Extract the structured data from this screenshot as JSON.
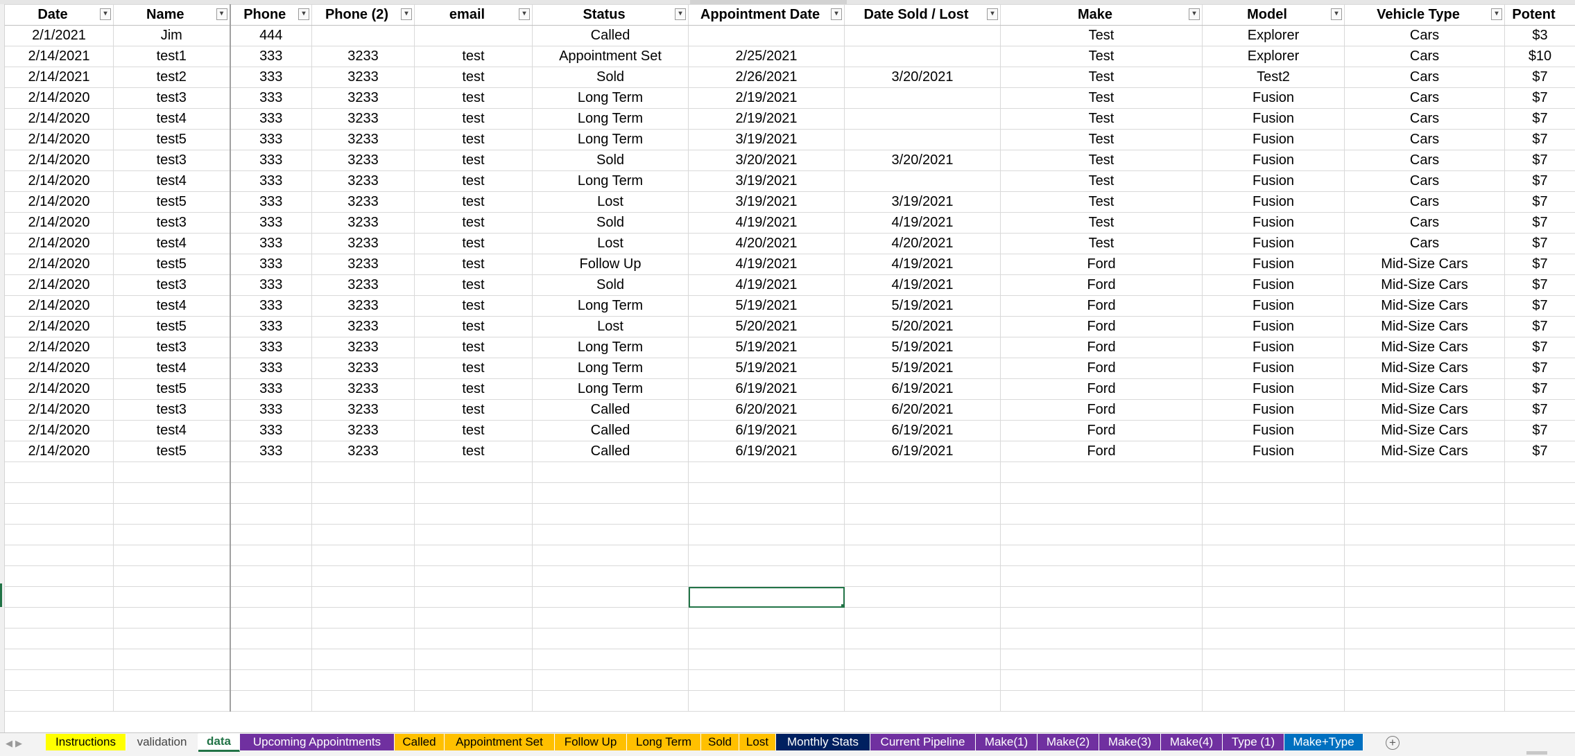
{
  "columns": [
    {
      "label": "Date",
      "width": 157,
      "filter": true
    },
    {
      "label": "Name",
      "width": 168,
      "filter": true,
      "freeze": true
    },
    {
      "label": "Phone",
      "width": 118,
      "filter": true
    },
    {
      "label": "Phone (2)",
      "width": 148,
      "filter": true
    },
    {
      "label": "email",
      "width": 170,
      "filter": true
    },
    {
      "label": "Status",
      "width": 225,
      "filter": true
    },
    {
      "label": "Appointment Date",
      "width": 225,
      "filter": true
    },
    {
      "label": "Date Sold / Lost",
      "width": 225,
      "filter": true
    },
    {
      "label": "Make",
      "width": 291,
      "filter": true
    },
    {
      "label": "Model",
      "width": 205,
      "filter": true
    },
    {
      "label": "Vehicle Type",
      "width": 231,
      "filter": true
    },
    {
      "label": "Potent",
      "width": 102,
      "filter": false,
      "align": "right"
    }
  ],
  "rows": [
    [
      "2/1/2021",
      "Jim",
      "444",
      "",
      "",
      "Called",
      "",
      "",
      "Test",
      "Explorer",
      "Cars",
      "$3"
    ],
    [
      "2/14/2021",
      "test1",
      "333",
      "3233",
      "test",
      "Appointment Set",
      "2/25/2021",
      "",
      "Test",
      "Explorer",
      "Cars",
      "$10"
    ],
    [
      "2/14/2021",
      "test2",
      "333",
      "3233",
      "test",
      "Sold",
      "2/26/2021",
      "3/20/2021",
      "Test",
      "Test2",
      "Cars",
      "$7"
    ],
    [
      "2/14/2020",
      "test3",
      "333",
      "3233",
      "test",
      "Long Term",
      "2/19/2021",
      "",
      "Test",
      "Fusion",
      "Cars",
      "$7"
    ],
    [
      "2/14/2020",
      "test4",
      "333",
      "3233",
      "test",
      "Long Term",
      "2/19/2021",
      "",
      "Test",
      "Fusion",
      "Cars",
      "$7"
    ],
    [
      "2/14/2020",
      "test5",
      "333",
      "3233",
      "test",
      "Long Term",
      "3/19/2021",
      "",
      "Test",
      "Fusion",
      "Cars",
      "$7"
    ],
    [
      "2/14/2020",
      "test3",
      "333",
      "3233",
      "test",
      "Sold",
      "3/20/2021",
      "3/20/2021",
      "Test",
      "Fusion",
      "Cars",
      "$7"
    ],
    [
      "2/14/2020",
      "test4",
      "333",
      "3233",
      "test",
      "Long Term",
      "3/19/2021",
      "",
      "Test",
      "Fusion",
      "Cars",
      "$7"
    ],
    [
      "2/14/2020",
      "test5",
      "333",
      "3233",
      "test",
      "Lost",
      "3/19/2021",
      "3/19/2021",
      "Test",
      "Fusion",
      "Cars",
      "$7"
    ],
    [
      "2/14/2020",
      "test3",
      "333",
      "3233",
      "test",
      "Sold",
      "4/19/2021",
      "4/19/2021",
      "Test",
      "Fusion",
      "Cars",
      "$7"
    ],
    [
      "2/14/2020",
      "test4",
      "333",
      "3233",
      "test",
      "Lost",
      "4/20/2021",
      "4/20/2021",
      "Test",
      "Fusion",
      "Cars",
      "$7"
    ],
    [
      "2/14/2020",
      "test5",
      "333",
      "3233",
      "test",
      "Follow Up",
      "4/19/2021",
      "4/19/2021",
      "Ford",
      "Fusion",
      "Mid-Size Cars",
      "$7"
    ],
    [
      "2/14/2020",
      "test3",
      "333",
      "3233",
      "test",
      "Sold",
      "4/19/2021",
      "4/19/2021",
      "Ford",
      "Fusion",
      "Mid-Size Cars",
      "$7"
    ],
    [
      "2/14/2020",
      "test4",
      "333",
      "3233",
      "test",
      "Long Term",
      "5/19/2021",
      "5/19/2021",
      "Ford",
      "Fusion",
      "Mid-Size Cars",
      "$7"
    ],
    [
      "2/14/2020",
      "test5",
      "333",
      "3233",
      "test",
      "Lost",
      "5/20/2021",
      "5/20/2021",
      "Ford",
      "Fusion",
      "Mid-Size Cars",
      "$7"
    ],
    [
      "2/14/2020",
      "test3",
      "333",
      "3233",
      "test",
      "Long Term",
      "5/19/2021",
      "5/19/2021",
      "Ford",
      "Fusion",
      "Mid-Size Cars",
      "$7"
    ],
    [
      "2/14/2020",
      "test4",
      "333",
      "3233",
      "test",
      "Long Term",
      "5/19/2021",
      "5/19/2021",
      "Ford",
      "Fusion",
      "Mid-Size Cars",
      "$7"
    ],
    [
      "2/14/2020",
      "test5",
      "333",
      "3233",
      "test",
      "Long Term",
      "6/19/2021",
      "6/19/2021",
      "Ford",
      "Fusion",
      "Mid-Size Cars",
      "$7"
    ],
    [
      "2/14/2020",
      "test3",
      "333",
      "3233",
      "test",
      "Called",
      "6/20/2021",
      "6/20/2021",
      "Ford",
      "Fusion",
      "Mid-Size Cars",
      "$7"
    ],
    [
      "2/14/2020",
      "test4",
      "333",
      "3233",
      "test",
      "Called",
      "6/19/2021",
      "6/19/2021",
      "Ford",
      "Fusion",
      "Mid-Size Cars",
      "$7"
    ],
    [
      "2/14/2020",
      "test5",
      "333",
      "3233",
      "test",
      "Called",
      "6/19/2021",
      "6/19/2021",
      "Ford",
      "Fusion",
      "Mid-Size Cars",
      "$7"
    ]
  ],
  "empty_rows": 12,
  "selected_cell": {
    "row": 27,
    "col": 6
  },
  "sheet_tabs": [
    {
      "label": "Instructions",
      "bg": "#ffff00",
      "color": "#000000",
      "width": 116
    },
    {
      "label": "validation",
      "bg": "#f3f3f3",
      "color": "#444444",
      "width": 104
    },
    {
      "label": "data",
      "bg": "#ffffff",
      "color": "#217346",
      "active": true,
      "width": 60
    },
    {
      "label": "Upcoming Appointments",
      "bg": "#7030a0",
      "color": "#ffffff",
      "width": 223
    },
    {
      "label": "Called",
      "bg": "#ffc000",
      "color": "#000000",
      "width": 72
    },
    {
      "label": "Appointment Set",
      "bg": "#ffc000",
      "color": "#000000",
      "width": 159
    },
    {
      "label": "Follow Up",
      "bg": "#ffc000",
      "color": "#000000",
      "width": 104
    },
    {
      "label": "Long Term",
      "bg": "#ffc000",
      "color": "#000000",
      "width": 107
    },
    {
      "label": "Sold",
      "bg": "#ffc000",
      "color": "#000000",
      "width": 55
    },
    {
      "label": "Lost",
      "bg": "#ffc000",
      "color": "#000000",
      "width": 53
    },
    {
      "label": "Monthly Stats",
      "bg": "#002060",
      "color": "#ffffff",
      "width": 136
    },
    {
      "label": "Current Pipeline",
      "bg": "#7030a0",
      "color": "#ffffff",
      "width": 152
    },
    {
      "label": "Make(1)",
      "bg": "#7030a0",
      "color": "#ffffff",
      "width": 89
    },
    {
      "label": "Make(2)",
      "bg": "#7030a0",
      "color": "#ffffff",
      "width": 89
    },
    {
      "label": "Make(3)",
      "bg": "#7030a0",
      "color": "#ffffff",
      "width": 89
    },
    {
      "label": "Make(4)",
      "bg": "#7030a0",
      "color": "#ffffff",
      "width": 89
    },
    {
      "label": "Type (1)",
      "bg": "#7030a0",
      "color": "#ffffff",
      "width": 89
    },
    {
      "label": "Make+Type",
      "bg": "#0070c0",
      "color": "#ffffff",
      "width": 114
    }
  ],
  "icons": {
    "filter": "filter-dropdown-icon",
    "add_sheet": "add-sheet-icon",
    "nav_prev": "scroll-left-icon",
    "nav_next": "scroll-right-icon"
  },
  "colors": {
    "accent": "#217346",
    "gridline": "#d9d9d9"
  }
}
